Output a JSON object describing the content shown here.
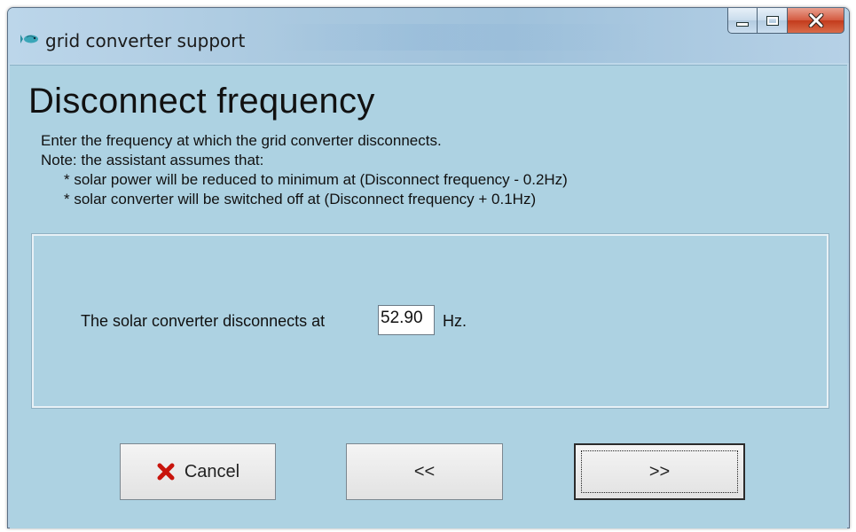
{
  "window": {
    "title": "grid converter support",
    "icon": "app-fish-icon",
    "controls": {
      "minimize": "minimize-icon",
      "maximize": "maximize-icon",
      "close": "close-icon"
    }
  },
  "page": {
    "heading": "Disconnect frequency",
    "description": [
      "Enter the frequency at which the grid converter disconnects.",
      "Note: the assistant assumes that:",
      "* solar power will be reduced to minimum at (Disconnect frequency - 0.2Hz)",
      "* solar converter will be switched off at (Disconnect frequency + 0.1Hz)"
    ]
  },
  "frequency": {
    "label": "The solar converter disconnects at",
    "value": "52.90",
    "unit": "Hz."
  },
  "buttons": {
    "cancel": "Cancel",
    "back": "<<",
    "next": ">>"
  },
  "colors": {
    "client_bg": "#add2e2",
    "cancel_icon": "#c8140c"
  }
}
